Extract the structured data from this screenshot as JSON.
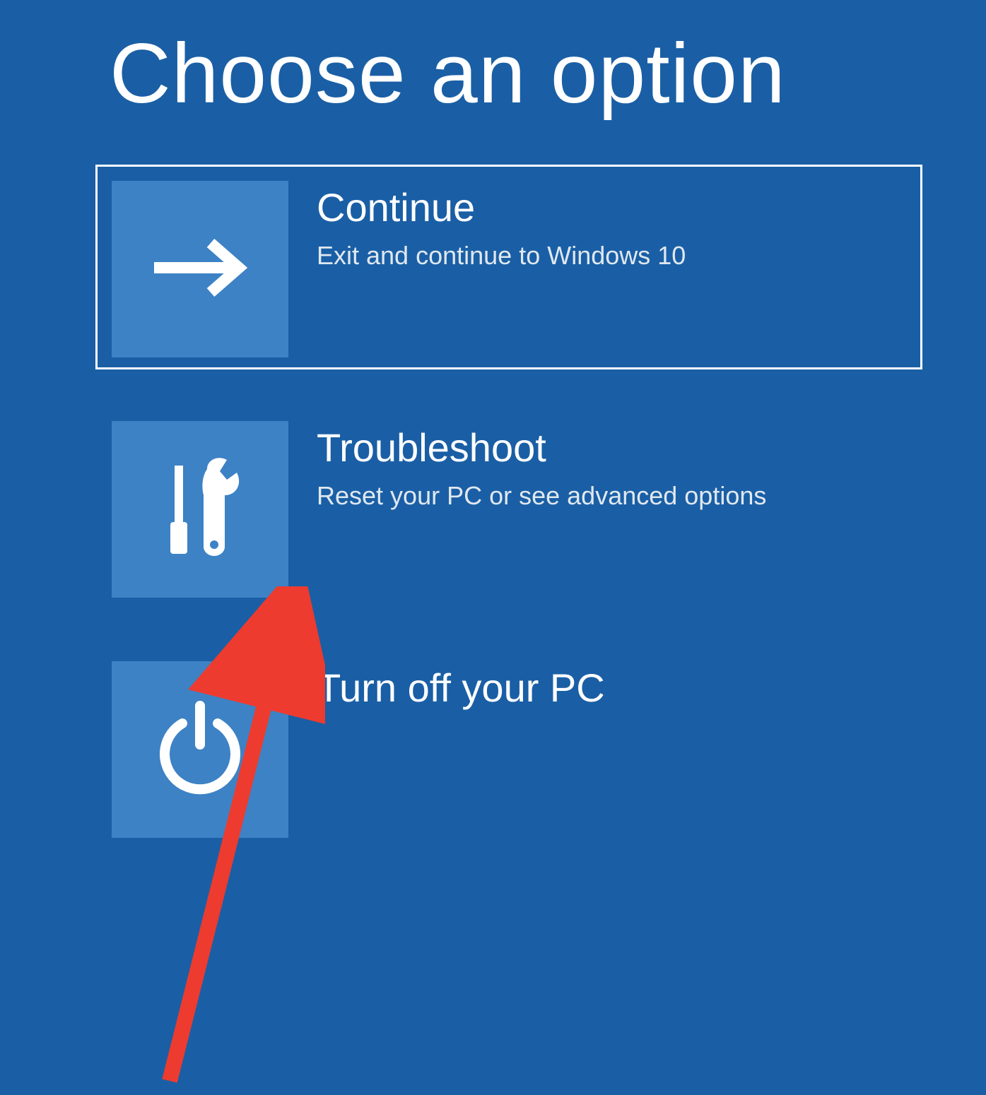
{
  "page": {
    "title": "Choose an option"
  },
  "options": [
    {
      "title": "Continue",
      "description": "Exit and continue to Windows 10",
      "selected": true,
      "icon": "arrow-right"
    },
    {
      "title": "Troubleshoot",
      "description": "Reset your PC or see advanced options",
      "selected": false,
      "icon": "tools"
    },
    {
      "title": "Turn off your PC",
      "description": "",
      "selected": false,
      "icon": "power"
    }
  ],
  "colors": {
    "background": "#1a5fa5",
    "tile": "#3d82c4",
    "text": "#ffffff",
    "annotation": "#ed3b2f"
  }
}
